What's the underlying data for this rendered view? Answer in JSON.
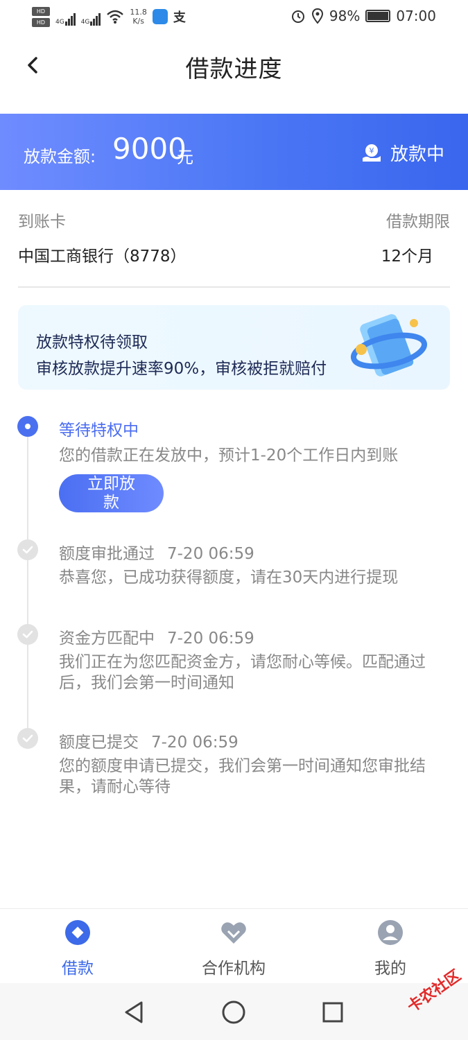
{
  "status_bar": {
    "net_speed_value": "11.8",
    "net_speed_unit": "K/s",
    "alipay_glyph": "支",
    "battery": "98%",
    "time": "07:00",
    "hd_label": "HD",
    "network_label": "4G"
  },
  "header": {
    "title": "借款进度"
  },
  "banner": {
    "amount_label": "放款金额:",
    "amount": "9000",
    "unit": "元",
    "status": "放款中"
  },
  "loan_info": {
    "card_label": "到账卡",
    "card_value": "中国工商银行（8778）",
    "term_label": "借款期限",
    "term_value": "12个月"
  },
  "promo": {
    "title": "放款特权待领取",
    "subtitle": "审核放款提升速率90%，审核被拒就赔付"
  },
  "timeline": {
    "step1": {
      "title": "等待特权中",
      "desc": "您的借款正在发放中，预计1-20个工作日内到账",
      "button": "立即放款"
    },
    "step2": {
      "title": "额度审批通过",
      "time": "7-20 06:59",
      "desc": "恭喜您，已成功获得额度，请在30天内进行提现"
    },
    "step3": {
      "title": "资金方匹配中",
      "time": "7-20 06:59",
      "desc": "我们正在为您匹配资金方，请您耐心等候。匹配通过后，我们会第一时间通知"
    },
    "step4": {
      "title": "额度已提交",
      "time": "7-20 06:59",
      "desc": "您的额度申请已提交，我们会第一时间通知您审批结果，请耐心等待"
    }
  },
  "bottom_nav": {
    "items": [
      {
        "label": "借款",
        "icon": "loan-icon",
        "active": true
      },
      {
        "label": "合作机构",
        "icon": "partner-icon",
        "active": false
      },
      {
        "label": "我的",
        "icon": "profile-icon",
        "active": false
      }
    ]
  },
  "watermark": "卡农社区",
  "colors": {
    "accent": "#4a6cf0",
    "banner_start": "#6f8cff",
    "banner_end": "#3a66ee",
    "muted_text": "#888888"
  }
}
